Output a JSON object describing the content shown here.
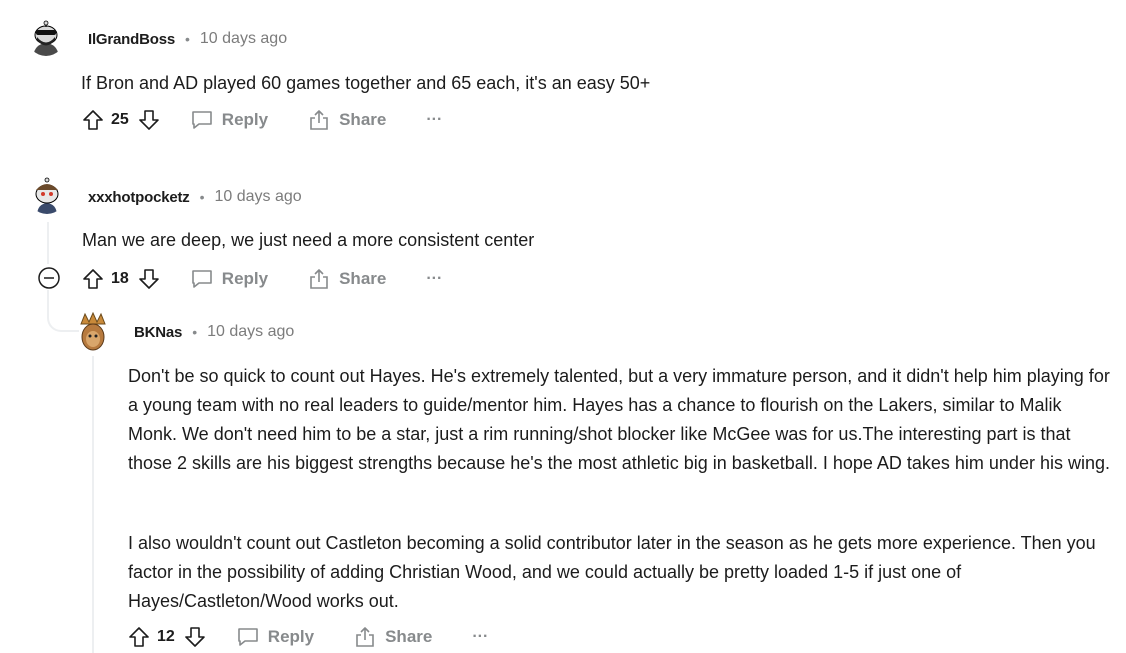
{
  "comments": [
    {
      "author": "IlGrandBoss",
      "separator": "•",
      "time": "10 days ago",
      "body": "If Bron and AD played 60 games together and 65 each, it's an easy 50+",
      "score": "25",
      "reply_label": "Reply",
      "share_label": "Share",
      "more_label": "···"
    },
    {
      "author": "xxxhotpocketz",
      "separator": "•",
      "time": "10 days ago",
      "body": "Man we are deep, we just need a more consistent center",
      "score": "18",
      "reply_label": "Reply",
      "share_label": "Share",
      "more_label": "···"
    },
    {
      "author": "BKNas",
      "separator": "•",
      "time": "10 days ago",
      "body_p1": "Don't be so quick to count out Hayes. He's extremely talented, but a very immature person, and it didn't help him playing for a young team with no real leaders to guide/mentor him. Hayes has a chance to flourish on the Lakers, similar to Malik Monk. We don't need him to be a star, just a rim running/shot blocker like McGee was for us.The interesting part is that those 2 skills are his biggest strengths because he's the most athletic big in basketball. I hope AD takes him under his wing.",
      "body_p2": "I also wouldn't count out Castleton becoming a solid contributor later in the season as he gets more experience. Then you factor in the possibility of adding Christian Wood, and we could actually be pretty loaded 1-5 if just one of Hayes/Castleton/Wood works out.",
      "score": "12",
      "reply_label": "Reply",
      "share_label": "Share",
      "more_label": "···"
    }
  ],
  "icons": {
    "upvote": "arrow-up-outline",
    "downvote": "arrow-down-outline",
    "reply": "speech-bubble-outline",
    "share": "share-box-arrow",
    "collapse": "circle-minus"
  }
}
